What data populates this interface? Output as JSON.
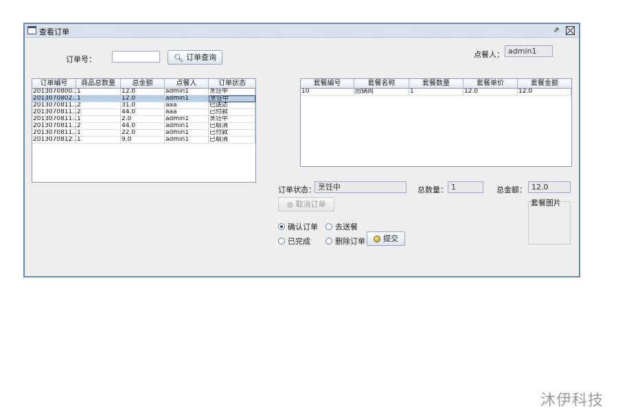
{
  "window": {
    "title": "查看订单"
  },
  "search": {
    "label": "订单号：",
    "value": "",
    "button": "订单查询"
  },
  "diner": {
    "label": "点餐人：",
    "value": "admin1"
  },
  "orders": {
    "headers": [
      "订单编号",
      "商品总数量",
      "总金额",
      "点餐人",
      "订单状态"
    ],
    "rows": [
      [
        "2013070800...",
        "1",
        "12.0",
        "admin1",
        "烹饪中"
      ],
      [
        "2013070802...",
        "1",
        "12.0",
        "admin1",
        "烹饪中"
      ],
      [
        "2013070811...",
        "2",
        "31.0",
        "aaa",
        "已送达"
      ],
      [
        "2013070811...",
        "2",
        "44.0",
        "aaa",
        "已付款"
      ],
      [
        "2013070811...",
        "1",
        "2.0",
        "admin1",
        "烹饪中"
      ],
      [
        "2013070811...",
        "2",
        "44.0",
        "admin1",
        "已取消"
      ],
      [
        "2013070811...",
        "1",
        "22.0",
        "admin1",
        "已付款"
      ],
      [
        "2013070812...",
        "1",
        "9.0",
        "admin1",
        "已取消"
      ]
    ]
  },
  "details": {
    "headers": [
      "套餐编号",
      "套餐名称",
      "套餐数量",
      "套餐单价",
      "套餐金额"
    ],
    "rows": [
      [
        "10",
        "回锅肉",
        "1",
        "12.0",
        "12.0"
      ]
    ]
  },
  "status": {
    "label": "订单状态：",
    "value": "烹饪中"
  },
  "quantity": {
    "label": "总数量：",
    "value": "1"
  },
  "amount": {
    "label": "总金额：",
    "value": "12.0"
  },
  "cancel_button": "取消订单",
  "image_box": {
    "label": "套餐图片"
  },
  "radios": {
    "confirm": "确认订单",
    "deliver": "去送餐",
    "complete": "已完成",
    "delete": "删除订单"
  },
  "submit_button": "提交",
  "watermark": "沐伊科技"
}
